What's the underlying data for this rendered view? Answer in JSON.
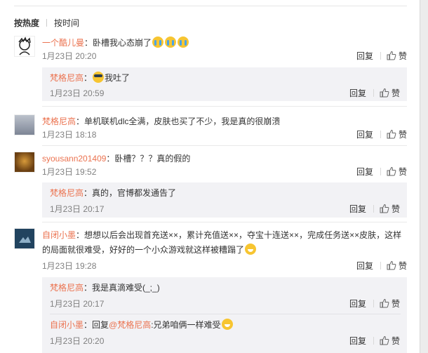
{
  "sort": {
    "active": "按热度",
    "other": "按时间"
  },
  "actions": {
    "reply": "回复",
    "like": "赞"
  },
  "comments": [
    {
      "user": "一个酷儿曼",
      "text": "：卧槽我心态崩了",
      "emojis": [
        "cry-emoji",
        "cry-emoji",
        "cry-emoji"
      ],
      "time": "1月23日 20:20",
      "replies": [
        {
          "user": "梵格尼高",
          "text": "我吐了",
          "emoji": "vomit-emoji",
          "time": "1月23日 20:59"
        }
      ]
    },
    {
      "user": "梵格尼高",
      "text": "：单机联机dlc全满，皮肤也买了不少，我是真的很崩溃",
      "time": "1月23日 18:18",
      "replies": []
    },
    {
      "user": "syousann201409",
      "text": "：卧槽？？？真的假的",
      "time": "1月23日 19:52",
      "replies": [
        {
          "user": "梵格尼高",
          "text": "：真的，官博都发通告了",
          "time": "1月23日 20:17"
        }
      ]
    },
    {
      "user": "自闭小墨",
      "text": "：想想以后会出现首充送××，累计充值送××，夺宝十连送××，完成任务送××皮肤，这样的局面就很难受，好好的一个小众游戏就这样被糟蹋了",
      "emoji": "grin-sweat-emoji",
      "time": "1月23日 19:28",
      "replies": [
        {
          "user": "梵格尼高",
          "text": "：我是真滴难受(_;_)",
          "time": "1月23日 20:17"
        },
        {
          "user": "自闭小墨",
          "text_prefix": "：回复",
          "mention": "@梵格尼高",
          "text": ":兄弟咱俩一样难受",
          "emoji": "tongue-emoji",
          "time": "1月23日 20:20"
        }
      ]
    }
  ]
}
